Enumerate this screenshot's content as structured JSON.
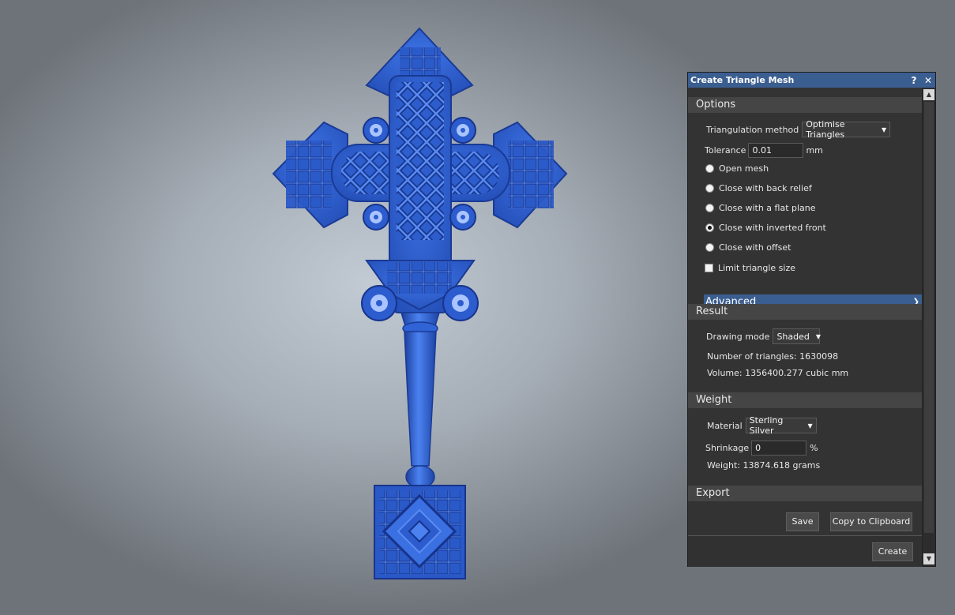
{
  "dialog": {
    "title": "Create Triangle Mesh",
    "help_label": "?",
    "close_label": "✕"
  },
  "options": {
    "header": "Options",
    "triangulation_label": "Triangulation method",
    "triangulation_value": "Optimise Triangles",
    "tolerance_label": "Tolerance",
    "tolerance_value": "0.01",
    "tolerance_unit": "mm",
    "radios": [
      {
        "label": "Open mesh",
        "checked": false
      },
      {
        "label": "Close with back relief",
        "checked": false
      },
      {
        "label": "Close with a flat plane",
        "checked": false
      },
      {
        "label": "Close with inverted front",
        "checked": true
      },
      {
        "label": "Close with offset",
        "checked": false
      }
    ],
    "limit_label": "Limit triangle size",
    "limit_checked": false,
    "advanced_label": "Advanced"
  },
  "result": {
    "header": "Result",
    "drawing_mode_label": "Drawing mode",
    "drawing_mode_value": "Shaded",
    "triangles_text": "Number of triangles: 1630098",
    "volume_text": "Volume: 1356400.277 cubic mm"
  },
  "weight": {
    "header": "Weight",
    "material_label": "Material",
    "material_value": "Sterling Silver",
    "shrinkage_label": "Shrinkage",
    "shrinkage_value": "0",
    "shrinkage_unit": "%",
    "weight_text": "Weight: 13874.618 grams"
  },
  "export": {
    "header": "Export",
    "save_label": "Save",
    "clipboard_label": "Copy to Clipboard"
  },
  "footer": {
    "create_label": "Create"
  },
  "colors": {
    "accent": "#3b5e91",
    "model_blue": "#2f63d6",
    "panel_bg": "#333333"
  }
}
